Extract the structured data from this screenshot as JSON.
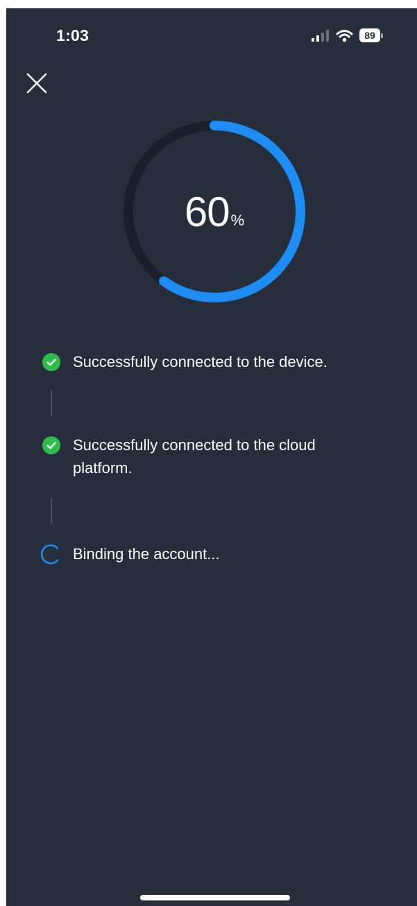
{
  "status_bar": {
    "time": "1:03",
    "battery": "89",
    "icons": [
      "signal-icon",
      "wifi-icon",
      "battery-icon"
    ]
  },
  "header": {
    "close_icon": "close-icon"
  },
  "progress": {
    "value": "60",
    "unit": "%",
    "fraction": 0.6,
    "track_color": "#1a2029",
    "fill_color": "#1e8cf5"
  },
  "steps": [
    {
      "label": "Successfully connected to the device.",
      "status": "done",
      "icon": "check-circle-icon"
    },
    {
      "label": "Successfully connected to the cloud platform.",
      "status": "done",
      "icon": "check-circle-icon"
    },
    {
      "label": "Binding the account...",
      "status": "in-progress",
      "icon": "spinner-icon"
    }
  ],
  "colors": {
    "background": "#262e3b",
    "success": "#2ebd4a",
    "accent": "#1e8cf5"
  }
}
